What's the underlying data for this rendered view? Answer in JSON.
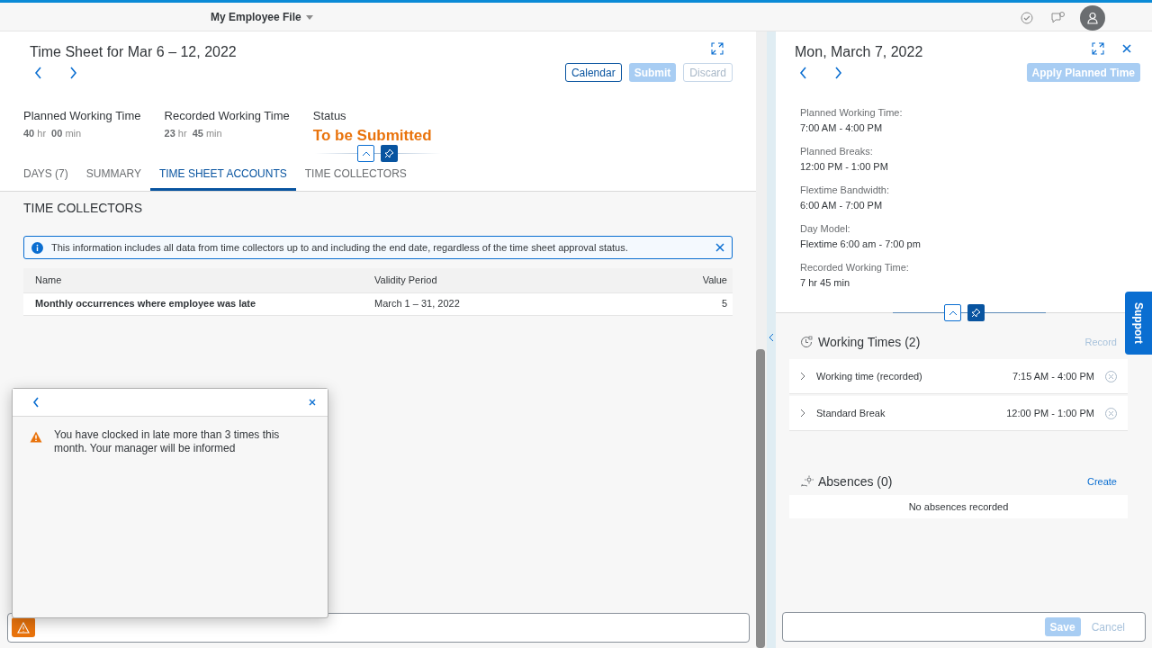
{
  "shell": {
    "title": "My Employee File"
  },
  "timesheet": {
    "title": "Time Sheet for Mar 6 – 12, 2022",
    "actions": [
      {
        "label": "Calendar",
        "kind": "outline",
        "disabled": false
      },
      {
        "label": "Submit",
        "kind": "emphasized",
        "disabled": true
      },
      {
        "label": "Discard",
        "kind": "outline",
        "disabled": true
      }
    ],
    "kpis": [
      {
        "label": "Planned Working Time",
        "hours": "40",
        "hours_unit": "hr",
        "minutes": "00",
        "minutes_unit": "min"
      },
      {
        "label": "Recorded Working Time",
        "hours": "23",
        "hours_unit": "hr",
        "minutes": "45",
        "minutes_unit": "min"
      }
    ],
    "status": {
      "label": "Status",
      "value": "To be Submitted"
    },
    "tabs": [
      {
        "label": "DAYS (7)",
        "selected": false
      },
      {
        "label": "SUMMARY",
        "selected": false
      },
      {
        "label": "TIME SHEET ACCOUNTS",
        "selected": true
      },
      {
        "label": "TIME COLLECTORS",
        "selected": false
      }
    ],
    "section_title": "TIME COLLECTORS",
    "info_strip": "This information includes all data from time collectors up to and including the end date, regardless of the time sheet approval status.",
    "table": {
      "columns": [
        "Name",
        "Validity Period",
        "Value"
      ],
      "rows": [
        [
          "Monthly occurrences where employee was late",
          "March 1 – 31, 2022",
          "5"
        ]
      ]
    }
  },
  "message_popover": {
    "text": "You have clocked in late more than 3 times this month. Your manager will be informed"
  },
  "detail": {
    "title": "Mon, March 7, 2022",
    "apply_button": {
      "label": "Apply Planned Time",
      "disabled": true
    },
    "fields": [
      {
        "label": "Planned Working Time:",
        "value": "7:00 AM - 4:00 PM"
      },
      {
        "label": "Planned Breaks:",
        "value": "12:00 PM - 1:00 PM"
      },
      {
        "label": "Flextime Bandwidth:",
        "value": "6:00 AM - 7:00 PM"
      },
      {
        "label": "Day Model:",
        "value": "Flextime 6:00 am - 7:00 pm"
      },
      {
        "label": "Recorded Working Time:",
        "value": "7 hr 45 min"
      }
    ],
    "working_times": {
      "title": "Working Times (2)",
      "action": {
        "label": "Record",
        "disabled": true
      },
      "items": [
        {
          "label": "Working time (recorded)",
          "time": "7:15 AM - 4:00 PM",
          "expanded": false
        },
        {
          "label": "Standard Break",
          "time": "12:00 PM - 1:00 PM",
          "expanded": false
        }
      ]
    },
    "absences": {
      "title": "Absences (0)",
      "action": {
        "label": "Create",
        "disabled": false
      },
      "empty_text": "No absences recorded"
    },
    "footer": [
      {
        "label": "Save",
        "kind": "emphasized",
        "disabled": true
      },
      {
        "label": "Cancel",
        "kind": "transparent",
        "disabled": true
      }
    ]
  },
  "support_tab": "Support"
}
